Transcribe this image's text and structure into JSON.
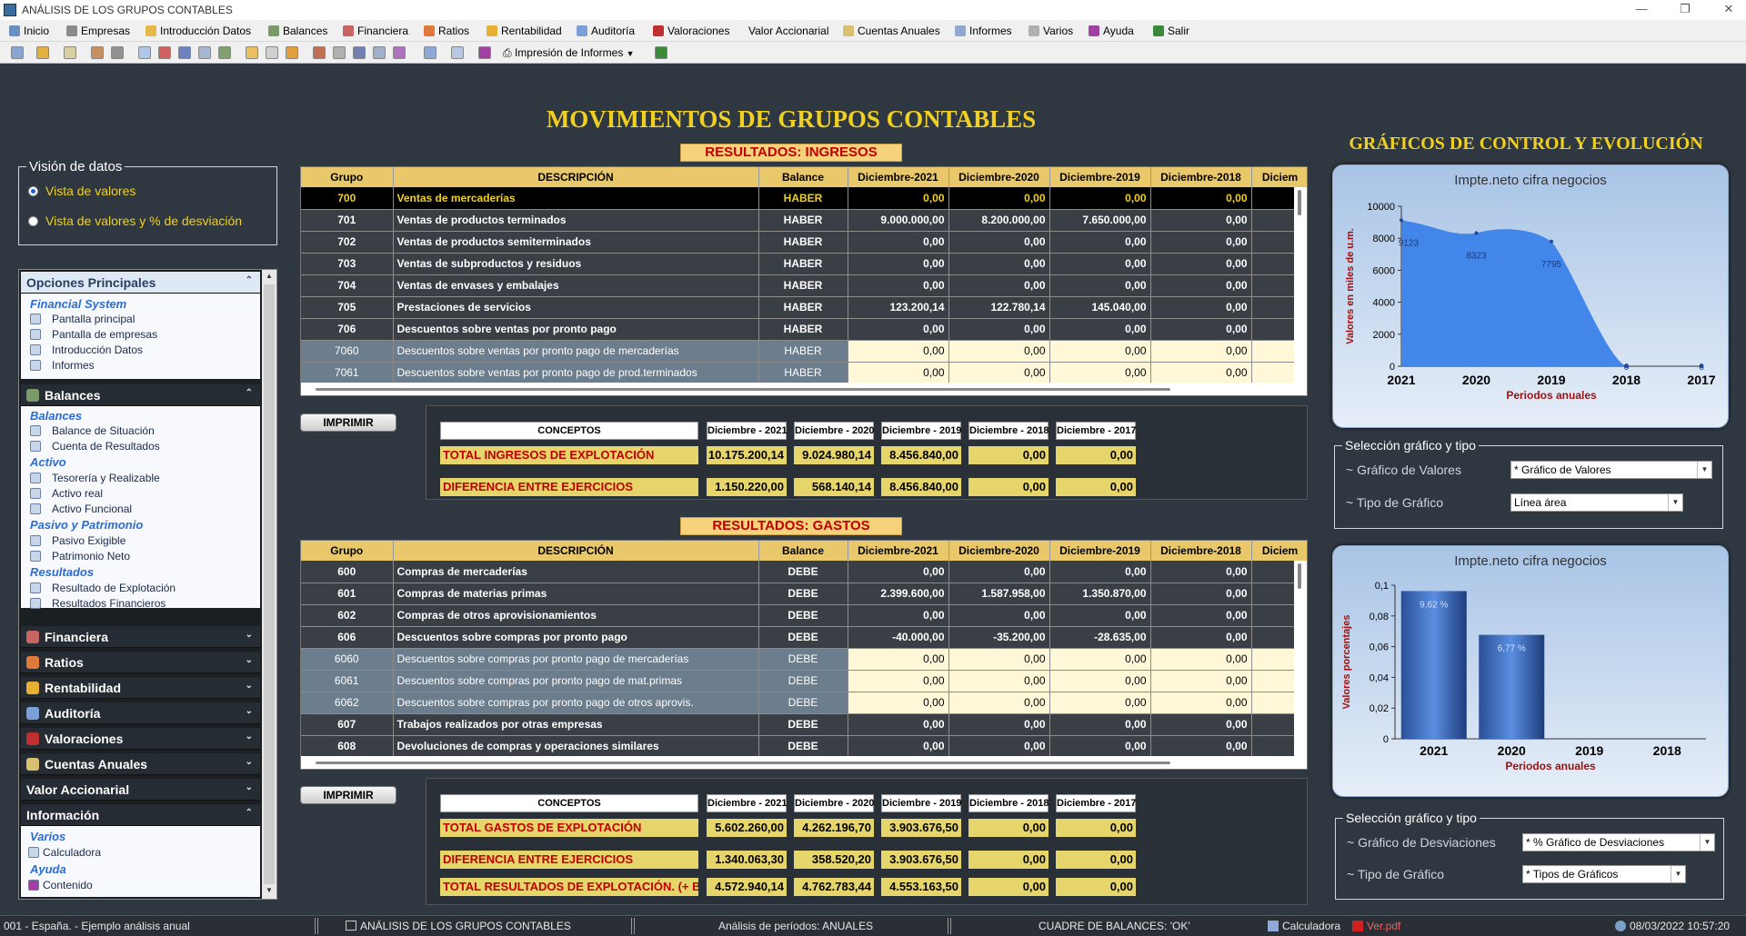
{
  "window": {
    "title": "ANÁLISIS DE LOS GRUPOS CONTABLES"
  },
  "menu": [
    "Inicio",
    "Empresas",
    "Introducción Datos",
    "Balances",
    "Financiera",
    "Ratios",
    "Rentabilidad",
    "Auditoría",
    "Valoraciones",
    "Valor Accionarial",
    "Cuentas Anuales",
    "Informes",
    "Varios",
    "Ayuda",
    "Salir"
  ],
  "toolbar": {
    "print_label": "Impresión de Informes"
  },
  "main_title": "MOVIMIENTOS DE GRUPOS CONTABLES",
  "graphs_title": "GRÁFICOS DE CONTROL Y EVOLUCIÓN",
  "vision": {
    "legend": "Visión de datos",
    "opt1": "Vista de valores",
    "opt2": "Vista de valores y % de desviación"
  },
  "sidebar": {
    "principal": {
      "title": "Opciones Principales",
      "category": "Financial System",
      "items": [
        "Pantalla principal",
        "Pantalla de empresas",
        "Introducción Datos",
        "Informes"
      ]
    },
    "balances": {
      "title": "Balances",
      "groups": [
        {
          "cat": "Balances",
          "items": [
            "Balance de Situación",
            "Cuenta de Resultados"
          ]
        },
        {
          "cat": "Activo",
          "items": [
            "Tesorería y Realizable",
            "Activo real",
            "Activo Funcional"
          ]
        },
        {
          "cat": "Pasivo y Patrimonio",
          "items": [
            "Pasivo Exigible",
            "Patrimonio Neto"
          ]
        },
        {
          "cat": "Resultados",
          "items": [
            "Resultado de Explotación",
            "Resultados Financieros"
          ]
        }
      ]
    },
    "collapsed": [
      "Financiera",
      "Ratios",
      "Rentabilidad",
      "Auditoría",
      "Valoraciones",
      "Cuentas Anuales",
      "Valor Accionarial"
    ],
    "info": {
      "title": "Información",
      "groups": [
        {
          "cat": "Varios",
          "items": [
            "Calculadora"
          ]
        },
        {
          "cat": "Ayuda",
          "items": [
            "Contenido"
          ]
        }
      ]
    }
  },
  "ingresos": {
    "band": "RESULTADOS: INGRESOS",
    "headers": [
      "Grupo",
      "DESCRIPCIÓN",
      "Balance",
      "Diciembre-2021",
      "Diciembre-2020",
      "Diciembre-2019",
      "Diciembre-2018",
      "Diciem"
    ],
    "rows": [
      {
        "s": "sel",
        "c": [
          "700",
          "Ventas de mercaderías",
          "HABER",
          "0,00",
          "0,00",
          "0,00",
          "0,00"
        ]
      },
      {
        "s": "dark",
        "c": [
          "701",
          "Ventas de productos terminados",
          "HABER",
          "9.000.000,00",
          "8.200.000,00",
          "7.650.000,00",
          "0,00"
        ]
      },
      {
        "s": "dark",
        "c": [
          "702",
          "Ventas de productos semiterminados",
          "HABER",
          "0,00",
          "0,00",
          "0,00",
          "0,00"
        ]
      },
      {
        "s": "dark",
        "c": [
          "703",
          "Ventas de subproductos y residuos",
          "HABER",
          "0,00",
          "0,00",
          "0,00",
          "0,00"
        ]
      },
      {
        "s": "dark",
        "c": [
          "704",
          "Ventas de envases y embalajes",
          "HABER",
          "0,00",
          "0,00",
          "0,00",
          "0,00"
        ]
      },
      {
        "s": "dark",
        "c": [
          "705",
          "Prestaciones de servicios",
          "HABER",
          "123.200,14",
          "122.780,14",
          "145.040,00",
          "0,00"
        ]
      },
      {
        "s": "dark",
        "c": [
          "706",
          "Descuentos sobre ventas por pronto pago",
          "HABER",
          "0,00",
          "0,00",
          "0,00",
          "0,00"
        ]
      },
      {
        "s": "lt",
        "c": [
          "7060",
          "Descuentos sobre ventas por pronto pago de mercaderías",
          "HABER",
          "0,00",
          "0,00",
          "0,00",
          "0,00"
        ]
      },
      {
        "s": "lt",
        "c": [
          "7061",
          "Descuentos sobre ventas por pronto pago de prod.terminados",
          "HABER",
          "0,00",
          "0,00",
          "0,00",
          "0,00"
        ]
      }
    ],
    "print": "IMPRIMIR",
    "summary": {
      "headers": [
        "CONCEPTOS",
        "Diciembre - 2021",
        "Diciembre - 2020",
        "Diciembre - 2019",
        "Diciembre - 2018",
        "Diciembre - 2017"
      ],
      "rows": [
        {
          "label": "TOTAL INGRESOS DE EXPLOTACIÓN",
          "values": [
            "10.175.200,14",
            "9.024.980,14",
            "8.456.840,00",
            "0,00",
            "0,00"
          ]
        },
        {
          "label": "DIFERENCIA ENTRE EJERCICIOS",
          "values": [
            "1.150.220,00",
            "568.140,14",
            "8.456.840,00",
            "0,00",
            "0,00"
          ]
        }
      ]
    }
  },
  "gastos": {
    "band": "RESULTADOS: GASTOS",
    "headers": [
      "Grupo",
      "DESCRIPCIÓN",
      "Balance",
      "Diciembre-2021",
      "Diciembre-2020",
      "Diciembre-2019",
      "Diciembre-2018",
      "Diciem"
    ],
    "rows": [
      {
        "s": "dark",
        "c": [
          "600",
          "Compras de mercaderías",
          "DEBE",
          "0,00",
          "0,00",
          "0,00",
          "0,00"
        ]
      },
      {
        "s": "dark",
        "c": [
          "601",
          "Compras de materias primas",
          "DEBE",
          "2.399.600,00",
          "1.587.958,00",
          "1.350.870,00",
          "0,00"
        ]
      },
      {
        "s": "dark",
        "c": [
          "602",
          "Compras de otros aprovisionamientos",
          "DEBE",
          "0,00",
          "0,00",
          "0,00",
          "0,00"
        ]
      },
      {
        "s": "dark",
        "c": [
          "606",
          "Descuentos sobre compras por pronto pago",
          "DEBE",
          "-40.000,00",
          "-35.200,00",
          "-28.635,00",
          "0,00"
        ]
      },
      {
        "s": "lt",
        "c": [
          "6060",
          "Descuentos sobre compras por pronto pago de mercaderías",
          "DEBE",
          "0,00",
          "0,00",
          "0,00",
          "0,00"
        ]
      },
      {
        "s": "lt",
        "c": [
          "6061",
          "Descuentos sobre compras por pronto pago de mat.primas",
          "DEBE",
          "0,00",
          "0,00",
          "0,00",
          "0,00"
        ]
      },
      {
        "s": "lt",
        "c": [
          "6062",
          "Descuentos sobre compras por pronto pago de otros aprovis.",
          "DEBE",
          "0,00",
          "0,00",
          "0,00",
          "0,00"
        ]
      },
      {
        "s": "dark",
        "c": [
          "607",
          "Trabajos realizados por otras empresas",
          "DEBE",
          "0,00",
          "0,00",
          "0,00",
          "0,00"
        ]
      },
      {
        "s": "dark",
        "c": [
          "608",
          "Devoluciones de compras y operaciones similares",
          "DEBE",
          "0,00",
          "0,00",
          "0,00",
          "0,00"
        ]
      }
    ],
    "print": "IMPRIMIR",
    "summary": {
      "headers": [
        "CONCEPTOS",
        "Diciembre - 2021",
        "Diciembre - 2020",
        "Diciembre - 2019",
        "Diciembre - 2018",
        "Diciembre - 2017"
      ],
      "rows": [
        {
          "label": "TOTAL GASTOS DE EXPLOTACIÓN",
          "values": [
            "5.602.260,00",
            "4.262.196,70",
            "3.903.676,50",
            "0,00",
            "0,00"
          ]
        },
        {
          "label": "DIFERENCIA ENTRE EJERCICIOS",
          "values": [
            "1.340.063,30",
            "358.520,20",
            "3.903.676,50",
            "0,00",
            "0,00"
          ]
        },
        {
          "label": "TOTAL RESULTADOS DE EXPLOTACIÓN. (+ BENE...",
          "values": [
            "4.572.940,14",
            "4.762.783,44",
            "4.553.163,50",
            "0,00",
            "0,00"
          ]
        }
      ]
    }
  },
  "chart1": {
    "title": "Impte.neto cifra negocios",
    "ylabel": "Valores en miles de u.m.",
    "xlabel": "Periodos anuales",
    "categories": [
      "2021",
      "2020",
      "2019",
      "2018",
      "2017"
    ],
    "values": [
      9123,
      8323,
      7795,
      0,
      0
    ],
    "labels": [
      "9123",
      "8323",
      "7795",
      "0",
      "0"
    ],
    "yticks": [
      "0",
      "2000",
      "4000",
      "6000",
      "8000",
      "10000"
    ],
    "ymax": 10000,
    "color": "#3a82e8"
  },
  "sel1": {
    "legend": "Selección gráfico y tipo",
    "l1": "~ Gráfico de Valores",
    "d1": "* Gráfico de Valores",
    "l2": "~ Tipo de Gráfico",
    "d2": "Línea área"
  },
  "chart2": {
    "title": "Impte.neto cifra negocios",
    "ylabel": "Valores porcentajes",
    "xlabel": "Periodos anuales",
    "categories": [
      "2021",
      "2020",
      "2019",
      "2018"
    ],
    "values": [
      0.0962,
      0.0677,
      0,
      0
    ],
    "labels": [
      "9,62 %",
      "6,77 %"
    ],
    "yticks": [
      "0",
      "0,02",
      "0,04",
      "0,06",
      "0,08",
      "0,1"
    ],
    "ymax": 0.1
  },
  "sel2": {
    "legend": "Selección gráfico y tipo",
    "l1": "~ Gráfico de Desviaciones",
    "d1": "* % Gráfico de Desviaciones",
    "l2": "~ Tipo de Gráfico",
    "d2": "* Tipos de Gráficos"
  },
  "status": {
    "company": "001 - España. - Ejemplo análisis anual",
    "module": "ANÁLISIS DE LOS GRUPOS CONTABLES",
    "periods": "Análisis de períodos: ANUALES",
    "cuadre": "CUADRE DE BALANCES:  'OK'",
    "calc": "Calculadora",
    "pdf": "Ver.pdf",
    "datetime": "08/03/2022 10:57:20"
  }
}
